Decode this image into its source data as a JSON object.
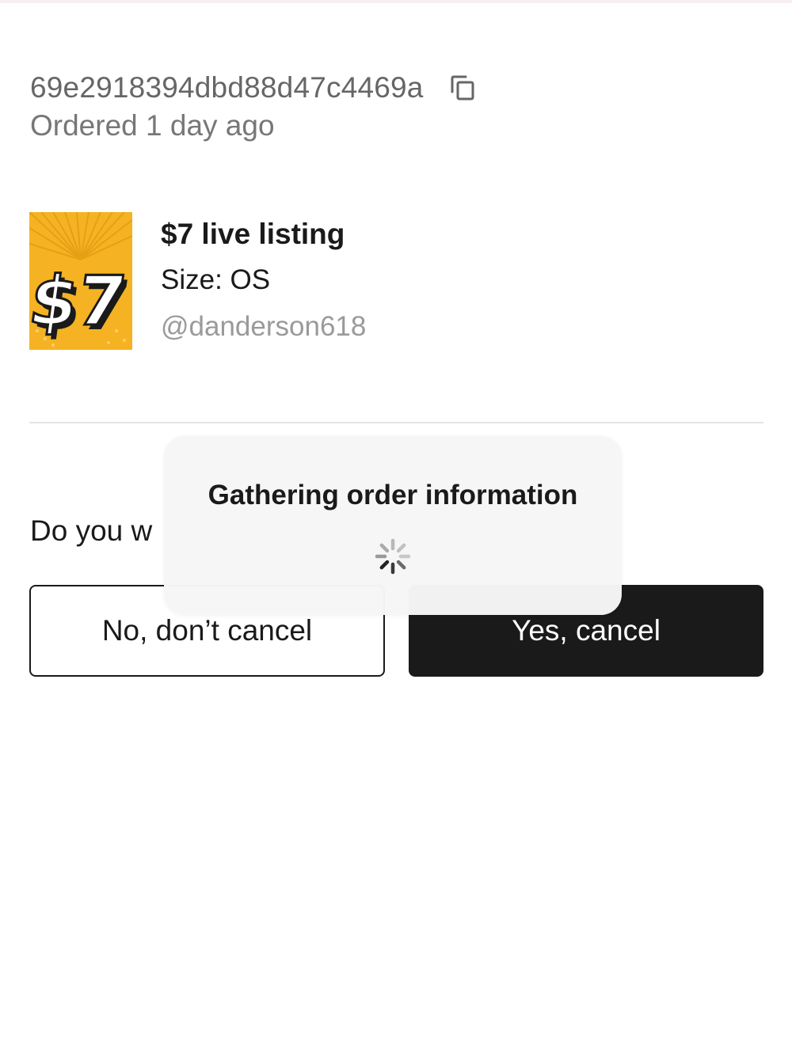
{
  "order": {
    "id": "69e2918394dbd88d47c4469a",
    "ordered_time": "Ordered 1 day ago"
  },
  "listing": {
    "thumbnail_text": "$7",
    "title": "$7 live listing",
    "size": "Size: OS",
    "seller": "@danderson618"
  },
  "cancel_prompt": {
    "question": "Do you w"
  },
  "buttons": {
    "no_label": "No, don’t cancel",
    "yes_label": "Yes, cancel"
  },
  "loading": {
    "message": "Gathering order information"
  },
  "icons": {
    "copy": "copy-icon",
    "spinner": "loading-spinner-icon"
  },
  "colors": {
    "primary_button_bg": "#1a1a1a",
    "thumbnail_bg": "#f5b323",
    "secondary_text": "#777777",
    "muted_text": "#9a9a9a"
  }
}
